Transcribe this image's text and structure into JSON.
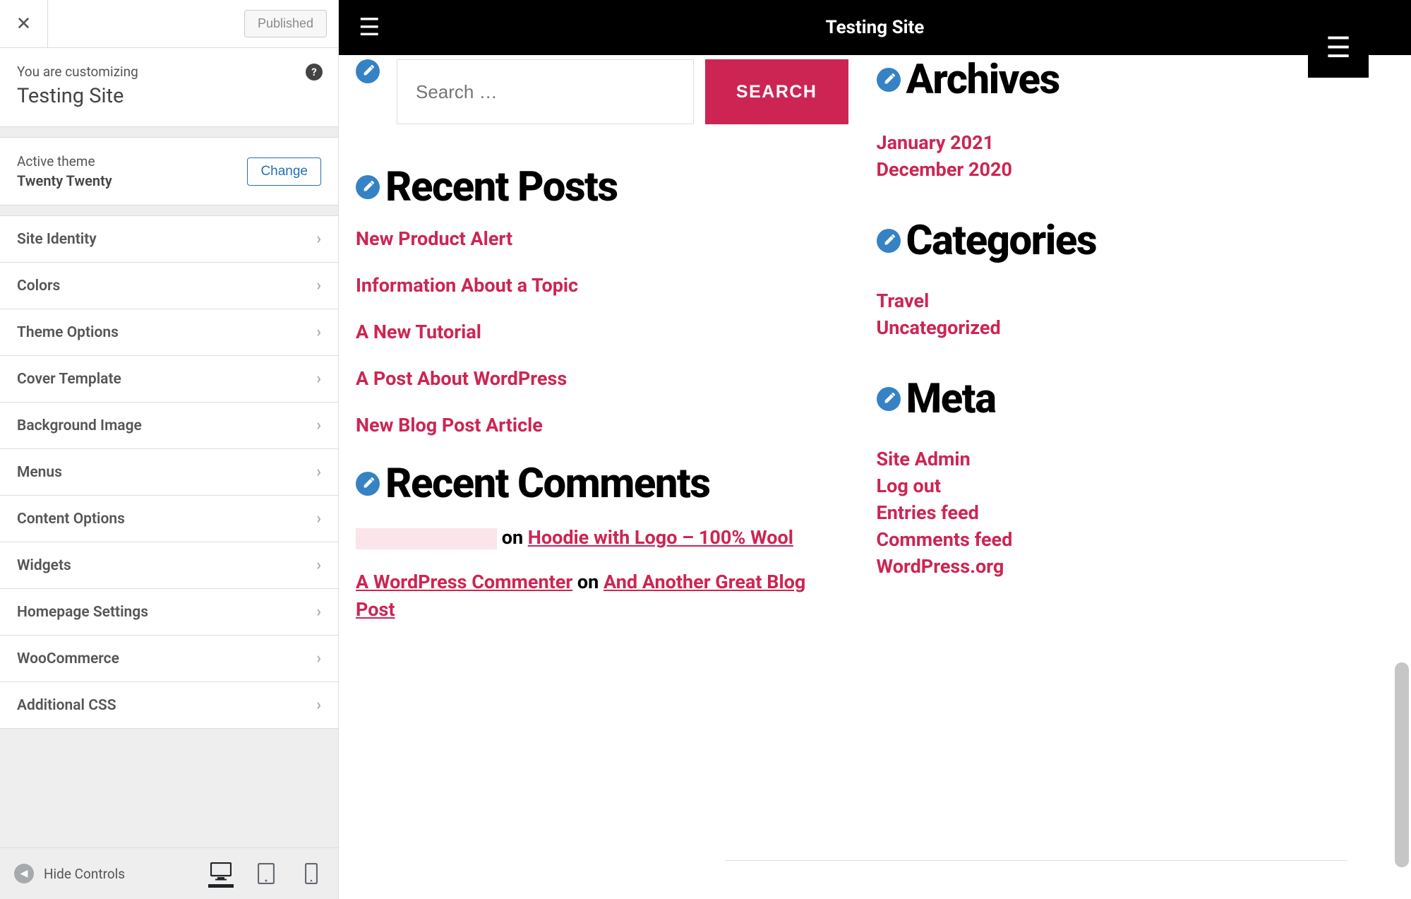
{
  "sidebar": {
    "published_label": "Published",
    "customizing_label": "You are customizing",
    "site_name": "Testing Site",
    "active_theme_label": "Active theme",
    "active_theme_name": "Twenty Twenty",
    "change_label": "Change",
    "panels": [
      "Site Identity",
      "Colors",
      "Theme Options",
      "Cover Template",
      "Background Image",
      "Menus",
      "Content Options",
      "Widgets",
      "Homepage Settings",
      "WooCommerce",
      "Additional CSS"
    ],
    "hide_controls_label": "Hide Controls"
  },
  "preview": {
    "site_title": "Testing Site",
    "search": {
      "placeholder": "Search …",
      "button": "SEARCH"
    },
    "recent_posts": {
      "title": "Recent Posts",
      "items": [
        "New Product Alert",
        "Information About a Topic",
        "A New Tutorial",
        "A Post About WordPress",
        "New Blog Post Article"
      ]
    },
    "recent_comments": {
      "title": "Recent Comments",
      "items": [
        {
          "author_redacted": true,
          "on": " on ",
          "target": "Hoodie with Logo – 100% Wool"
        },
        {
          "author": "A WordPress Commenter",
          "on": " on ",
          "target": "And Another Great Blog Post"
        }
      ]
    },
    "archives": {
      "title": "Archives",
      "items": [
        "January 2021",
        "December 2020"
      ]
    },
    "categories": {
      "title": "Categories",
      "items": [
        "Travel",
        "Uncategorized"
      ]
    },
    "meta": {
      "title": "Meta",
      "items": [
        "Site Admin",
        "Log out",
        "Entries feed",
        "Comments feed",
        "WordPress.org"
      ]
    }
  },
  "colors": {
    "accent": "#cd2553",
    "edit_badge": "#3582c4"
  }
}
